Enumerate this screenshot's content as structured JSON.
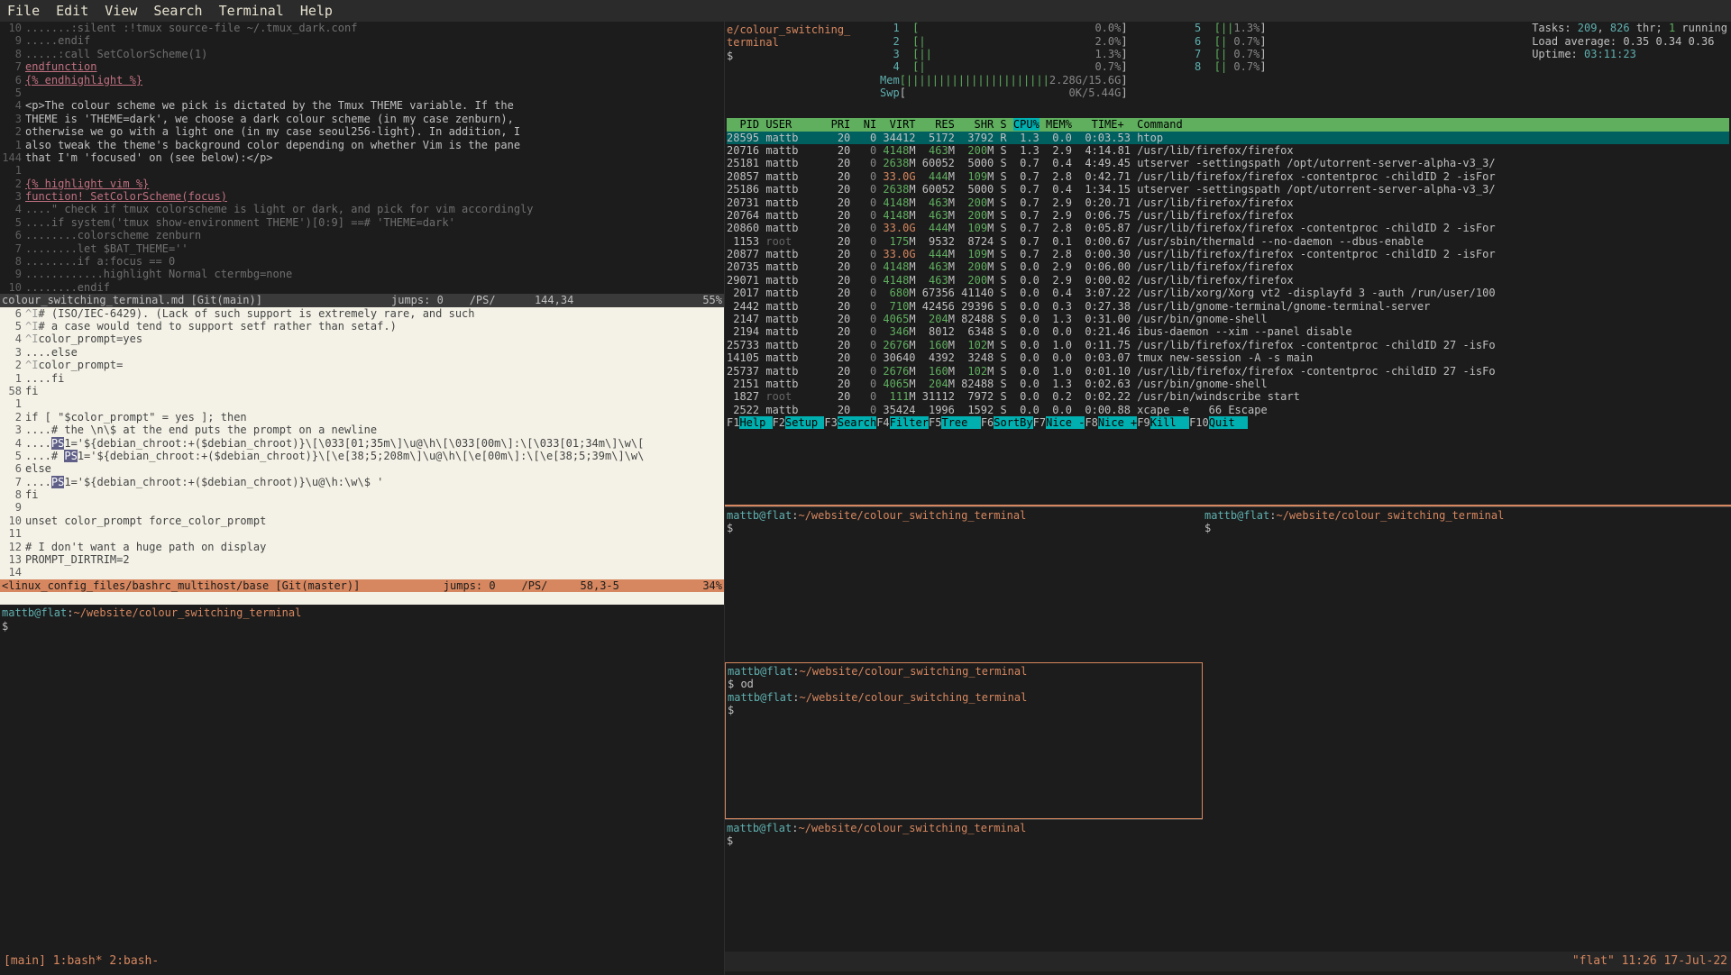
{
  "menu": [
    "File",
    "Edit",
    "View",
    "Search",
    "Terminal",
    "Help"
  ],
  "tmux": {
    "left": "[main] 1:bash* 2:bash-",
    "right": "\"flat\" 11:26 17-Jul-22"
  },
  "vim_top_lines": [
    {
      "n": "10",
      "t": ".......:silent :!tmux source-file ~/.tmux_dark.conf",
      "cls": "dim"
    },
    {
      "n": "9",
      "t": ".....endif",
      "cls": "dim"
    },
    {
      "n": "8",
      "t": ".....:call SetColorScheme(1)",
      "cls": "dim"
    },
    {
      "n": "7",
      "t": "endfunction",
      "cls": "link"
    },
    {
      "n": "6",
      "t": "{% endhighlight %}",
      "cls": "link"
    },
    {
      "n": "5",
      "t": "",
      "cls": ""
    },
    {
      "n": "4",
      "t": "<p>The colour scheme we pick is dictated by the Tmux THEME variable. If the",
      "cls": ""
    },
    {
      "n": "3",
      "t": "THEME is 'THEME=dark', we choose a dark colour scheme (in my case zenburn),",
      "cls": ""
    },
    {
      "n": "2",
      "t": "otherwise we go with a light one (in my case seoul256-light). In addition, I",
      "cls": ""
    },
    {
      "n": "1",
      "t": "also tweak the theme's background color depending on whether Vim is the pane",
      "cls": ""
    },
    {
      "n": "144",
      "t": "that I'm 'focused' on (see below):</p>",
      "cls": ""
    },
    {
      "n": "1",
      "t": "",
      "cls": ""
    },
    {
      "n": "2",
      "t": "{% highlight vim %}",
      "cls": "link"
    },
    {
      "n": "3",
      "t": "function! SetColorScheme(focus)",
      "cls": "link"
    },
    {
      "n": "4",
      "t": "....\" check if tmux colorscheme is light or dark, and pick for vim accordingly",
      "cls": "dim"
    },
    {
      "n": "5",
      "t": "....if system('tmux show-environment THEME')[0:9] ==# 'THEME=dark'",
      "cls": "dim"
    },
    {
      "n": "6",
      "t": "........colorscheme zenburn",
      "cls": "dim"
    },
    {
      "n": "7",
      "t": "........let $BAT_THEME=''",
      "cls": "dim"
    },
    {
      "n": "8",
      "t": "........if a:focus == 0",
      "cls": "dim"
    },
    {
      "n": "9",
      "t": "............highlight Normal ctermbg=none",
      "cls": "dim"
    },
    {
      "n": "10",
      "t": "........endif",
      "cls": "dim"
    }
  ],
  "status1": {
    "left": "colour_switching_terminal.md [Git(main)]",
    "mid": "jumps: 0    /PS/      144,34",
    "right": "55%"
  },
  "vim_light_lines": [
    {
      "n": "6",
      "t": "^I# (ISO/IEC-6429). (Lack of such support is extremely rare, and such"
    },
    {
      "n": "5",
      "t": "^I# a case would tend to support setf rather than setaf.)"
    },
    {
      "n": "4",
      "t": "^Icolor_prompt=yes"
    },
    {
      "n": "3",
      "t": "....else"
    },
    {
      "n": "2",
      "t": "^Icolor_prompt="
    },
    {
      "n": "1",
      "t": "....fi"
    },
    {
      "n": "58",
      "t": "fi"
    },
    {
      "n": "1",
      "t": ""
    },
    {
      "n": "2",
      "t": "if [ \"$color_prompt\" = yes ]; then"
    },
    {
      "n": "3",
      "t": "....# the \\n\\$ at the end puts the prompt on a newline"
    },
    {
      "n": "4",
      "t": "....PS1='${debian_chroot:+($debian_chroot)}\\[\\033[01;35m\\]\\u@\\h\\[\\033[00m\\]:\\[\\033[01;34m\\]\\w\\["
    },
    {
      "n": "5",
      "t": "....# PS1='${debian_chroot:+($debian_chroot)}\\[\\e[38;5;208m\\]\\u@\\h\\[\\e[00m\\]:\\[\\e[38;5;39m\\]\\w\\"
    },
    {
      "n": "6",
      "t": "else"
    },
    {
      "n": "7",
      "t": "....PS1='${debian_chroot:+($debian_chroot)}\\u@\\h:\\w\\$ '"
    },
    {
      "n": "8",
      "t": "fi"
    },
    {
      "n": "9",
      "t": ""
    },
    {
      "n": "10",
      "t": "unset color_prompt force_color_prompt"
    },
    {
      "n": "11",
      "t": ""
    },
    {
      "n": "12",
      "t": "# I don't want a huge path on display"
    },
    {
      "n": "13",
      "t": "PROMPT_DIRTRIM=2"
    },
    {
      "n": "14",
      "t": ""
    }
  ],
  "status2": {
    "left": "<linux_config_files/bashrc_multihost/base [Git(master)]",
    "mid": "jumps: 0    /PS/     58,3-5",
    "right": "34%"
  },
  "left_term": {
    "prompt": "mattb@flat:~/website/colour_switching_terminal",
    "ps": "$ "
  },
  "htop": {
    "title_a": "e/colour_switching_",
    "title_b": "terminal",
    "ps": "$",
    "cpus": [
      {
        "i": 1,
        "bar": "[",
        "pct": "0.0%"
      },
      {
        "i": 2,
        "bar": "[|",
        "pct": "2.0%"
      },
      {
        "i": 3,
        "bar": "[||",
        "pct": "1.3%"
      },
      {
        "i": 4,
        "bar": "[|",
        "pct": "0.7%"
      },
      {
        "i": 5,
        "bar": "[||",
        "pct": "1.3%"
      },
      {
        "i": 6,
        "bar": "[|",
        "pct": "0.7%"
      },
      {
        "i": 7,
        "bar": "[|",
        "pct": "0.7%"
      },
      {
        "i": 8,
        "bar": "[|",
        "pct": "0.7%"
      }
    ],
    "mem": {
      "label": "Mem",
      "bar": "[||||||||||||||||||||||",
      "val": "2.28G/15.6G"
    },
    "swp": {
      "label": "Swp",
      "bar": "[",
      "val": "0K/5.44G"
    },
    "tasks": "Tasks: 209, 826 thr; 1 running",
    "load": "Load average: 0.35 0.34 0.36",
    "uptime": "Uptime: 03:11:23",
    "header": "  PID USER      PRI  NI  VIRT   RES   SHR S CPU% MEM%   TIME+  Command",
    "selrow": "28595 mattb      20   0 34412  5172  3792 R  1.3  0.0  0:03.53 htop",
    "rows": [
      "20716 mattb      20   0 4148M  463M  200M S  1.3  2.9  4:14.81 /usr/lib/firefox/firefox",
      "25181 mattb      20   0 2638M 60052  5000 S  0.7  0.4  4:49.45 utserver -settingspath /opt/utorrent-server-alpha-v3_3/",
      "20857 mattb      20   0 33.0G  444M  109M S  0.7  2.8  0:42.71 /usr/lib/firefox/firefox -contentproc -childID 2 -isFor",
      "25186 mattb      20   0 2638M 60052  5000 S  0.7  0.4  1:34.15 utserver -settingspath /opt/utorrent-server-alpha-v3_3/",
      "20731 mattb      20   0 4148M  463M  200M S  0.7  2.9  0:20.71 /usr/lib/firefox/firefox",
      "20764 mattb      20   0 4148M  463M  200M S  0.7  2.9  0:06.75 /usr/lib/firefox/firefox",
      "20860 mattb      20   0 33.0G  444M  109M S  0.7  2.8  0:05.87 /usr/lib/firefox/firefox -contentproc -childID 2 -isFor",
      " 1153 root       20   0  175M  9532  8724 S  0.7  0.1  0:00.67 /usr/sbin/thermald --no-daemon --dbus-enable",
      "20877 mattb      20   0 33.0G  444M  109M S  0.7  2.8  0:00.30 /usr/lib/firefox/firefox -contentproc -childID 2 -isFor",
      "20735 mattb      20   0 4148M  463M  200M S  0.0  2.9  0:06.00 /usr/lib/firefox/firefox",
      "29071 mattb      20   0 4148M  463M  200M S  0.0  2.9  0:00.02 /usr/lib/firefox/firefox",
      " 2017 mattb      20   0  680M 67356 41140 S  0.0  0.4  3:07.22 /usr/lib/xorg/Xorg vt2 -displayfd 3 -auth /run/user/100",
      " 2442 mattb      20   0  710M 42456 29396 S  0.0  0.3  0:27.38 /usr/lib/gnome-terminal/gnome-terminal-server",
      " 2147 mattb      20   0 4065M  204M 82488 S  0.0  1.3  0:31.00 /usr/bin/gnome-shell",
      " 2194 mattb      20   0  346M  8012  6348 S  0.0  0.0  0:21.46 ibus-daemon --xim --panel disable",
      "25733 mattb      20   0 2676M  160M  102M S  0.0  1.0  0:11.75 /usr/lib/firefox/firefox -contentproc -childID 27 -isFo",
      "14105 mattb      20   0 30640  4392  3248 S  0.0  0.0  0:03.07 tmux new-session -A -s main",
      "25737 mattb      20   0 2676M  160M  102M S  0.0  1.0  0:01.10 /usr/lib/firefox/firefox -contentproc -childID 27 -isFo",
      " 2151 mattb      20   0 4065M  204M 82488 S  0.0  1.3  0:02.63 /usr/bin/gnome-shell",
      " 1827 root       20   0  111M 31112  7972 S  0.0  0.2  0:02.22 /usr/bin/windscribe start",
      " 2522 mattb      20   0 35424  1996  1592 S  0.0  0.0  0:00.88 xcape -e   66 Escape"
    ],
    "fkeys": [
      {
        "k": "F1",
        "v": "Help "
      },
      {
        "k": "F2",
        "v": "Setup "
      },
      {
        "k": "F3",
        "v": "Search"
      },
      {
        "k": "F4",
        "v": "Filter"
      },
      {
        "k": "F5",
        "v": "Tree  "
      },
      {
        "k": "F6",
        "v": "SortBy"
      },
      {
        "k": "F7",
        "v": "Nice -"
      },
      {
        "k": "F8",
        "v": "Nice +"
      },
      {
        "k": "F9",
        "v": "Kill  "
      },
      {
        "k": "F10",
        "v": "Quit  "
      }
    ]
  },
  "mini_terms": {
    "a": {
      "prompt": "mattb@flat:~/website/colour_switching_terminal",
      "ps": "$ "
    },
    "b": {
      "prompt": "mattb@flat:~/website/colour_switching_terminal",
      "cmd": "$ od",
      "prompt2": "mattb@flat:~/website/colour_switching_terminal",
      "ps": "$ "
    },
    "c": {
      "prompt": "mattb@flat:~/website/colour_switching_terminal",
      "ps": "$ "
    },
    "d": {
      "prompt": "mattb@flat:~/website/colour_switching_terminal",
      "ps": "$ "
    }
  }
}
